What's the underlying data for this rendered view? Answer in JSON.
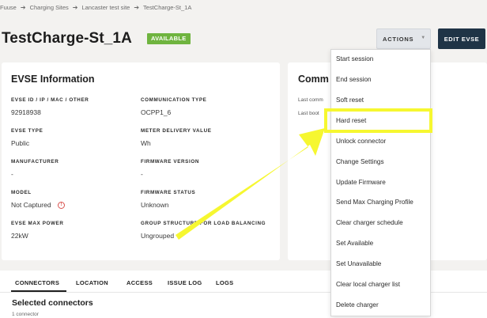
{
  "breadcrumb": {
    "items": [
      "Fuuse",
      "Charging Sites",
      "Lancaster test site",
      "TestCharge-St_1A"
    ],
    "separator": "➔"
  },
  "header": {
    "title": "TestCharge-St_1A",
    "status_badge": "AVAILABLE",
    "actions_label": "ACTIONS",
    "actions_caret": "▼",
    "edit_label": "EDIT EVSE"
  },
  "evse_info": {
    "heading": "EVSE Information",
    "fields": [
      {
        "label": "EVSE ID / IP / MAC / OTHER",
        "value": "92918938"
      },
      {
        "label": "COMMUNICATION TYPE",
        "value": "OCPP1_6"
      },
      {
        "label": "EVSE TYPE",
        "value": "Public"
      },
      {
        "label": "METER DELIVERY VALUE",
        "value": "Wh"
      },
      {
        "label": "MANUFACTURER",
        "value": "-"
      },
      {
        "label": "FIRMWARE VERSION",
        "value": "-"
      },
      {
        "label": "MODEL",
        "value": "Not Captured"
      },
      {
        "label": "FIRMWARE STATUS",
        "value": "Unknown"
      },
      {
        "label": "EVSE MAX POWER",
        "value": "22kW"
      },
      {
        "label": "GROUP STRUCTURE FOR LOAD BALANCING",
        "value": "Ungrouped"
      }
    ],
    "info_icon_glyph": "!"
  },
  "comm_card": {
    "heading": "Comm",
    "rows": [
      "Last comm",
      "Last boot"
    ]
  },
  "actions_menu": {
    "items": [
      "Start session",
      "End session",
      "Soft reset",
      "Hard reset",
      "Unlock connector",
      "Change Settings",
      "Update Firmware",
      "Send Max Charging Profile",
      "Clear charger schedule",
      "Set Available",
      "Set Unavailable",
      "Clear local charger list",
      "Delete charger"
    ],
    "highlighted": "Hard reset"
  },
  "tabs": {
    "items": [
      "CONNECTORS",
      "LOCATION",
      "ACCESS",
      "ISSUE LOG",
      "LOGS"
    ],
    "active": "CONNECTORS"
  },
  "connectors": {
    "title": "Selected connectors",
    "subtitle": "1 connector"
  },
  "colors": {
    "badge": "#6fb43f",
    "edit_button": "#1f3446",
    "annotation": "#f6f730",
    "warning": "#d9534f"
  }
}
